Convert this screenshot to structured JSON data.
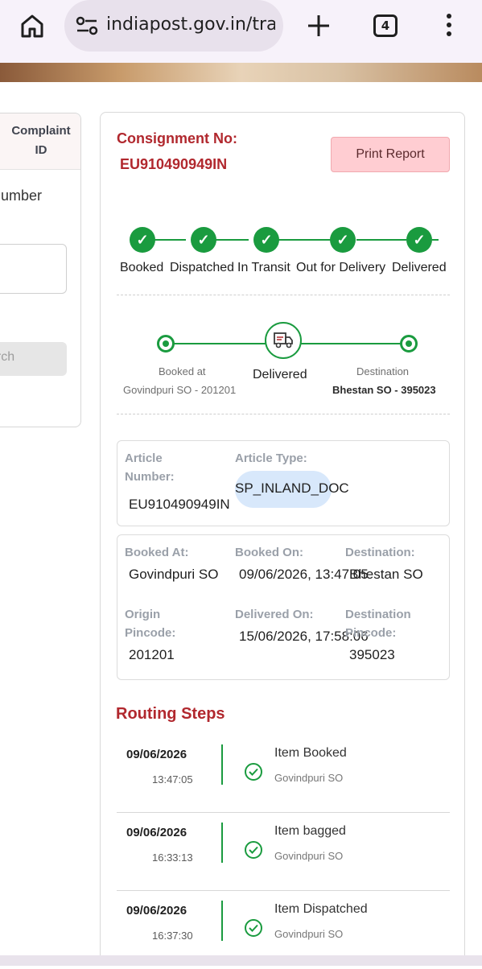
{
  "browser": {
    "url": "indiapost.gov.in/tra",
    "tab_count": "4"
  },
  "left_panel": {
    "complaint_header": "Complaint ID",
    "number_label": "umber",
    "search_label": "arch"
  },
  "consignment": {
    "label": "Consignment No:",
    "number": "EU910490949IN",
    "print_button": "Print Report"
  },
  "progress_steps": [
    {
      "label": "Booked",
      "done": true
    },
    {
      "label": "Dispatched",
      "done": true
    },
    {
      "label": "In Transit",
      "done": true
    },
    {
      "label": "Out for Delivery",
      "done": true
    },
    {
      "label": "Delivered",
      "done": true
    }
  ],
  "route_summary": {
    "booked_at_label": "Booked at",
    "booked_at_value": "Govindpuri SO - 201201",
    "status": "Delivered",
    "destination_label": "Destination",
    "destination_value": "Bhestan SO - 395023"
  },
  "article": {
    "number_label": "Article Number:",
    "number_value": "EU910490949IN",
    "type_label": "Article Type:",
    "type_value": "SP_INLAND_DOC"
  },
  "details": {
    "booked_at_label": "Booked At:",
    "booked_at_value": "Govindpuri SO",
    "booked_on_label": "Booked On:",
    "booked_on_value": "09/06/2026, 13:47:05",
    "destination_label": "Destination:",
    "destination_value": "Bhestan SO",
    "origin_pincode_label": "Origin Pincode:",
    "origin_pincode_value": "201201",
    "delivered_on_label": "Delivered On:",
    "delivered_on_value": "15/06/2026, 17:58:06",
    "destination_pincode_label": "Destination Pincode:",
    "destination_pincode_value": "395023"
  },
  "routing": {
    "title": "Routing Steps",
    "steps": [
      {
        "date": "09/06/2026",
        "time": "13:47:05",
        "event": "Item Booked",
        "office": "Govindpuri SO"
      },
      {
        "date": "09/06/2026",
        "time": "16:33:13",
        "event": "Item bagged",
        "office": "Govindpuri SO"
      },
      {
        "date": "09/06/2026",
        "time": "16:37:30",
        "event": "Item Dispatched",
        "office": "Govindpuri SO"
      }
    ]
  },
  "colors": {
    "accent_red": "#b1282e",
    "success_green": "#1a9b3f",
    "print_button_bg": "#ffcdd2"
  }
}
